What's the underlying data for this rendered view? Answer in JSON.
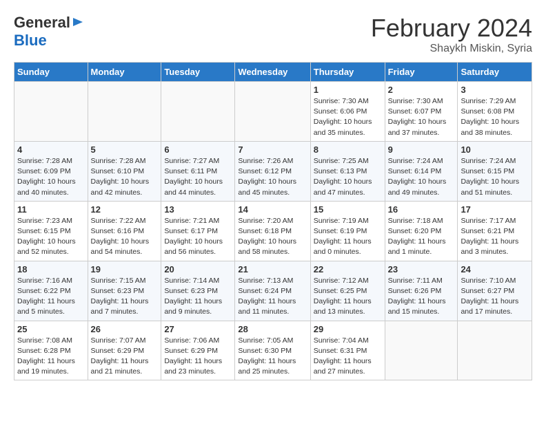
{
  "header": {
    "logo_general": "General",
    "logo_blue": "Blue",
    "month_year": "February 2024",
    "location": "Shaykh Miskin, Syria"
  },
  "days_of_week": [
    "Sunday",
    "Monday",
    "Tuesday",
    "Wednesday",
    "Thursday",
    "Friday",
    "Saturday"
  ],
  "weeks": [
    [
      {
        "day": "",
        "info": ""
      },
      {
        "day": "",
        "info": ""
      },
      {
        "day": "",
        "info": ""
      },
      {
        "day": "",
        "info": ""
      },
      {
        "day": "1",
        "info": "Sunrise: 7:30 AM\nSunset: 6:06 PM\nDaylight: 10 hours\nand 35 minutes."
      },
      {
        "day": "2",
        "info": "Sunrise: 7:30 AM\nSunset: 6:07 PM\nDaylight: 10 hours\nand 37 minutes."
      },
      {
        "day": "3",
        "info": "Sunrise: 7:29 AM\nSunset: 6:08 PM\nDaylight: 10 hours\nand 38 minutes."
      }
    ],
    [
      {
        "day": "4",
        "info": "Sunrise: 7:28 AM\nSunset: 6:09 PM\nDaylight: 10 hours\nand 40 minutes."
      },
      {
        "day": "5",
        "info": "Sunrise: 7:28 AM\nSunset: 6:10 PM\nDaylight: 10 hours\nand 42 minutes."
      },
      {
        "day": "6",
        "info": "Sunrise: 7:27 AM\nSunset: 6:11 PM\nDaylight: 10 hours\nand 44 minutes."
      },
      {
        "day": "7",
        "info": "Sunrise: 7:26 AM\nSunset: 6:12 PM\nDaylight: 10 hours\nand 45 minutes."
      },
      {
        "day": "8",
        "info": "Sunrise: 7:25 AM\nSunset: 6:13 PM\nDaylight: 10 hours\nand 47 minutes."
      },
      {
        "day": "9",
        "info": "Sunrise: 7:24 AM\nSunset: 6:14 PM\nDaylight: 10 hours\nand 49 minutes."
      },
      {
        "day": "10",
        "info": "Sunrise: 7:24 AM\nSunset: 6:15 PM\nDaylight: 10 hours\nand 51 minutes."
      }
    ],
    [
      {
        "day": "11",
        "info": "Sunrise: 7:23 AM\nSunset: 6:15 PM\nDaylight: 10 hours\nand 52 minutes."
      },
      {
        "day": "12",
        "info": "Sunrise: 7:22 AM\nSunset: 6:16 PM\nDaylight: 10 hours\nand 54 minutes."
      },
      {
        "day": "13",
        "info": "Sunrise: 7:21 AM\nSunset: 6:17 PM\nDaylight: 10 hours\nand 56 minutes."
      },
      {
        "day": "14",
        "info": "Sunrise: 7:20 AM\nSunset: 6:18 PM\nDaylight: 10 hours\nand 58 minutes."
      },
      {
        "day": "15",
        "info": "Sunrise: 7:19 AM\nSunset: 6:19 PM\nDaylight: 11 hours\nand 0 minutes."
      },
      {
        "day": "16",
        "info": "Sunrise: 7:18 AM\nSunset: 6:20 PM\nDaylight: 11 hours\nand 1 minute."
      },
      {
        "day": "17",
        "info": "Sunrise: 7:17 AM\nSunset: 6:21 PM\nDaylight: 11 hours\nand 3 minutes."
      }
    ],
    [
      {
        "day": "18",
        "info": "Sunrise: 7:16 AM\nSunset: 6:22 PM\nDaylight: 11 hours\nand 5 minutes."
      },
      {
        "day": "19",
        "info": "Sunrise: 7:15 AM\nSunset: 6:23 PM\nDaylight: 11 hours\nand 7 minutes."
      },
      {
        "day": "20",
        "info": "Sunrise: 7:14 AM\nSunset: 6:23 PM\nDaylight: 11 hours\nand 9 minutes."
      },
      {
        "day": "21",
        "info": "Sunrise: 7:13 AM\nSunset: 6:24 PM\nDaylight: 11 hours\nand 11 minutes."
      },
      {
        "day": "22",
        "info": "Sunrise: 7:12 AM\nSunset: 6:25 PM\nDaylight: 11 hours\nand 13 minutes."
      },
      {
        "day": "23",
        "info": "Sunrise: 7:11 AM\nSunset: 6:26 PM\nDaylight: 11 hours\nand 15 minutes."
      },
      {
        "day": "24",
        "info": "Sunrise: 7:10 AM\nSunset: 6:27 PM\nDaylight: 11 hours\nand 17 minutes."
      }
    ],
    [
      {
        "day": "25",
        "info": "Sunrise: 7:08 AM\nSunset: 6:28 PM\nDaylight: 11 hours\nand 19 minutes."
      },
      {
        "day": "26",
        "info": "Sunrise: 7:07 AM\nSunset: 6:29 PM\nDaylight: 11 hours\nand 21 minutes."
      },
      {
        "day": "27",
        "info": "Sunrise: 7:06 AM\nSunset: 6:29 PM\nDaylight: 11 hours\nand 23 minutes."
      },
      {
        "day": "28",
        "info": "Sunrise: 7:05 AM\nSunset: 6:30 PM\nDaylight: 11 hours\nand 25 minutes."
      },
      {
        "day": "29",
        "info": "Sunrise: 7:04 AM\nSunset: 6:31 PM\nDaylight: 11 hours\nand 27 minutes."
      },
      {
        "day": "",
        "info": ""
      },
      {
        "day": "",
        "info": ""
      }
    ]
  ]
}
